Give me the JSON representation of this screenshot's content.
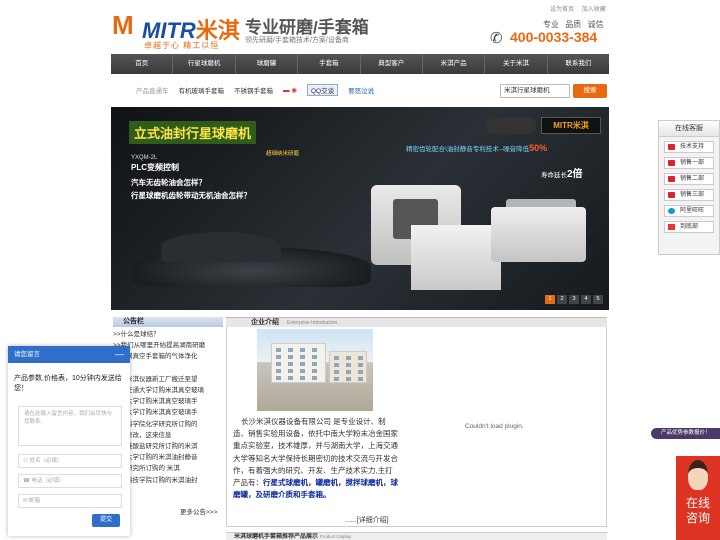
{
  "header": {
    "logo_text": "MITR",
    "logo_cn": "米淇",
    "logo_slogan": "卓越于心  精工以恒",
    "title": "专业研磨/手套箱",
    "subtitle": "领先研磨/手套箱技术/方案/设备商",
    "top_links": [
      "设为首页",
      "加入收藏"
    ],
    "values": "专业 品质 诚信",
    "phone": "400-0033-384"
  },
  "nav": [
    "首页",
    "行星球磨机",
    "球磨罐",
    "手套箱",
    "典型客户",
    "米淇产品",
    "关于米淇",
    "联系我们"
  ],
  "tags": {
    "label": "产品直通车",
    "items": [
      "有机玻璃手套箱",
      "不锈钢手套箱"
    ],
    "qq": "QQ交谈",
    "wordpress": "要怒泣说"
  },
  "search": {
    "value": "米淇行星球磨机",
    "button": "搜索"
  },
  "banner": {
    "title": "立式油封行星球磨机",
    "model": "YXQM-2L",
    "plc": "PLC变频控制",
    "q1": "汽车无齿轮油会怎样？",
    "q2": "行星球磨机齿轮带动无机油会怎样？",
    "center": "超细纳米研磨",
    "logo": "MITR米淇",
    "slogan_pre": "精密齿轮配合\\油封静音专利技术--噪音降低",
    "slogan_pct": "50%",
    "life_pre": "寿命延长",
    "life_val": "2倍",
    "pages": [
      "1",
      "2",
      "3",
      "4",
      "5"
    ]
  },
  "announcements": {
    "heading": "公告栏",
    "items": [
      ">>什么是球结？",
      ">>我们从哪里开始提高湖南研磨",
      "不锈钢真空手套箱的气体净化",
      "系统",
      "长沙米淇仪器新工厂搬迁至望",
      "西安交通大学订购米淇真空玻璃",
      "浙江大学订购米淇真空玻璃手",
      "四川大学订购米淇真空玻璃手",
      "中国科学院化学研究所订购的",
      "应用修改，这来信息",
      "上海硅酸盐研究所订购的米淇",
      "湖北大学订购的米淇油封静音",
      "广州研究所订购的 米淇",
      "山西科技学院订购的米淇油封"
    ],
    "more": "更多公告>>>"
  },
  "intro": {
    "heading": "企业介绍",
    "heading_en": "Enterprise Introduction",
    "text": "长沙米淇仪器设备有限公司 是专业设计、制造、销售实验用设备，依托中南大学粉末冶金国家重点实验室，技术雄厚，并与湖南大学，上海交通大学等知名大学保持长期密切的技术交流与开发合作，有着强大的研究、开发、生产技术实力,主打产品有：",
    "links": "行星式球磨机，罐磨机，搅拌球磨机，球磨罐，及研磨介质和手套箱。",
    "more": "......[详细介绍]",
    "plugin": "Couldn't load plugin."
  },
  "bottom_bar": {
    "title": "米淇球磨机手套箱推荐产品展示",
    "sub": "Product Display"
  },
  "service": {
    "heading": "在线客服",
    "items": [
      "技术支持",
      "销售一部",
      "销售二部",
      "销售三部",
      "阿里旺旺",
      "到底部"
    ]
  },
  "pill": "产品优势参数报价！",
  "online": {
    "line1": "在线",
    "line2": "咨询"
  },
  "chat": {
    "heading": "请您留言",
    "min": "—",
    "message": "产品参数,价格表，10分钟内发送给您！",
    "textarea": "请在此输入留言内容，我们会尽快与您联系。",
    "name": "姓名（必填）",
    "phone": "电话（必填）",
    "email": "邮箱",
    "send": "提交"
  },
  "colors": {
    "brand_orange": "#e86a10",
    "brand_blue": "#1a4fa0",
    "nav_dark": "#3a3a3a"
  }
}
